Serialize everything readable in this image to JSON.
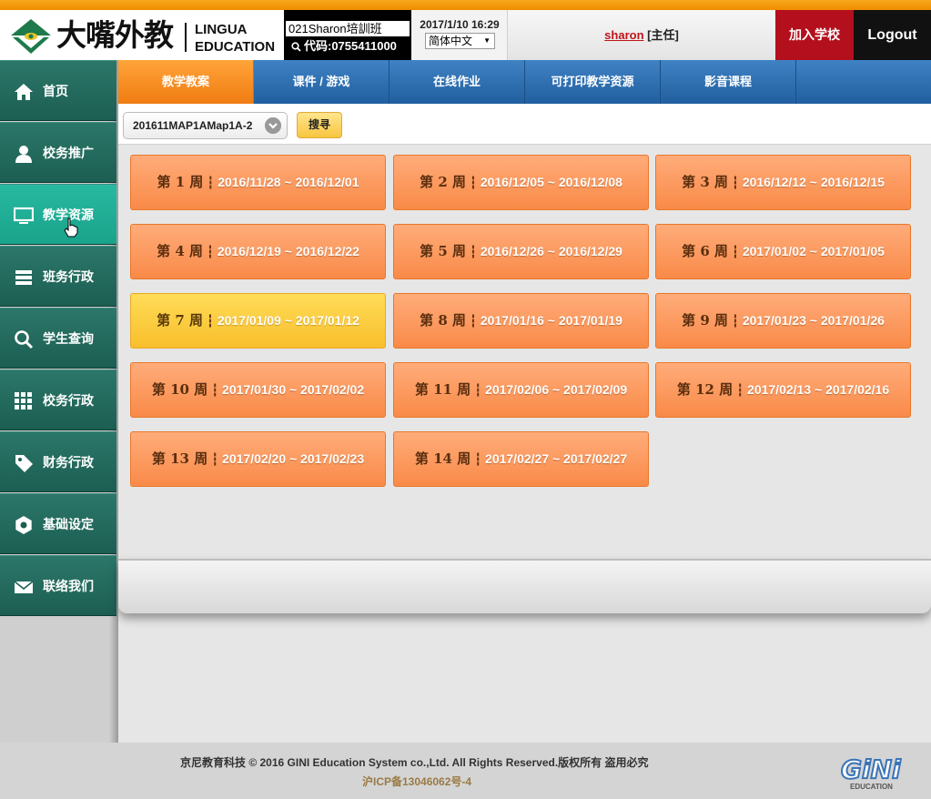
{
  "brand": {
    "cn_name": "大嘴外教",
    "en_line1": "LINGUA",
    "en_line2": "EDUCATION",
    "accent_orange": "#f08c00",
    "teal": "#1c5e52"
  },
  "header": {
    "school_name": "021Sharon培訓班",
    "school_code": "代码:0755411000",
    "datetime": "2017/1/10 16:29",
    "language": "简体中文",
    "user_name": "sharon",
    "user_role": "[主任]",
    "join_label": "加入学校",
    "logout_label": "Logout"
  },
  "sidebar": {
    "items": [
      {
        "label": "首页",
        "icon": "home-icon"
      },
      {
        "label": "校务推广",
        "icon": "user-icon"
      },
      {
        "label": "教学资源",
        "icon": "monitor-icon",
        "active": true
      },
      {
        "label": "班务行政",
        "icon": "list-icon"
      },
      {
        "label": "学生查询",
        "icon": "search-icon"
      },
      {
        "label": "校务行政",
        "icon": "grid-icon"
      },
      {
        "label": "财务行政",
        "icon": "tag-icon"
      },
      {
        "label": "基础设定",
        "icon": "gear-icon"
      },
      {
        "label": "联络我们",
        "icon": "mail-icon"
      }
    ]
  },
  "tabs": [
    {
      "label": "教学教案",
      "active": true
    },
    {
      "label": "课件 / 游戏"
    },
    {
      "label": "在线作业"
    },
    {
      "label": "可打印教学资源"
    },
    {
      "label": "影音课程"
    }
  ],
  "filter": {
    "course_value": "201611MAP1AMap1A-2",
    "search_label": "搜寻"
  },
  "weeks": [
    {
      "label": "第 1 周",
      "dates": "2016/11/28 ~ 2016/12/01"
    },
    {
      "label": "第 2 周",
      "dates": "2016/12/05 ~ 2016/12/08"
    },
    {
      "label": "第 3 周",
      "dates": "2016/12/12 ~ 2016/12/15"
    },
    {
      "label": "第 4 周",
      "dates": "2016/12/19 ~ 2016/12/22"
    },
    {
      "label": "第 5 周",
      "dates": "2016/12/26 ~ 2016/12/29"
    },
    {
      "label": "第 6 周",
      "dates": "2017/01/02 ~ 2017/01/05"
    },
    {
      "label": "第 7 周",
      "dates": "2017/01/09 ~ 2017/01/12",
      "current": true
    },
    {
      "label": "第 8 周",
      "dates": "2017/01/16 ~ 2017/01/19"
    },
    {
      "label": "第 9 周",
      "dates": "2017/01/23 ~ 2017/01/26"
    },
    {
      "label": "第 10 周",
      "dates": "2017/01/30 ~ 2017/02/02"
    },
    {
      "label": "第 11 周",
      "dates": "2017/02/06 ~ 2017/02/09"
    },
    {
      "label": "第 12 周",
      "dates": "2017/02/13 ~ 2017/02/16"
    },
    {
      "label": "第 13 周",
      "dates": "2017/02/20 ~ 2017/02/23"
    },
    {
      "label": "第 14 周",
      "dates": "2017/02/27 ~ 2017/02/27"
    }
  ],
  "footer": {
    "copyright": "京尼教育科技 © 2016 GINI Education System co.,Ltd. All Rights Reserved.版权所有 盗用必究",
    "icp": "沪ICP备13046062号-4",
    "logo_text": "GiNi",
    "logo_sub": "EDUCATION"
  }
}
